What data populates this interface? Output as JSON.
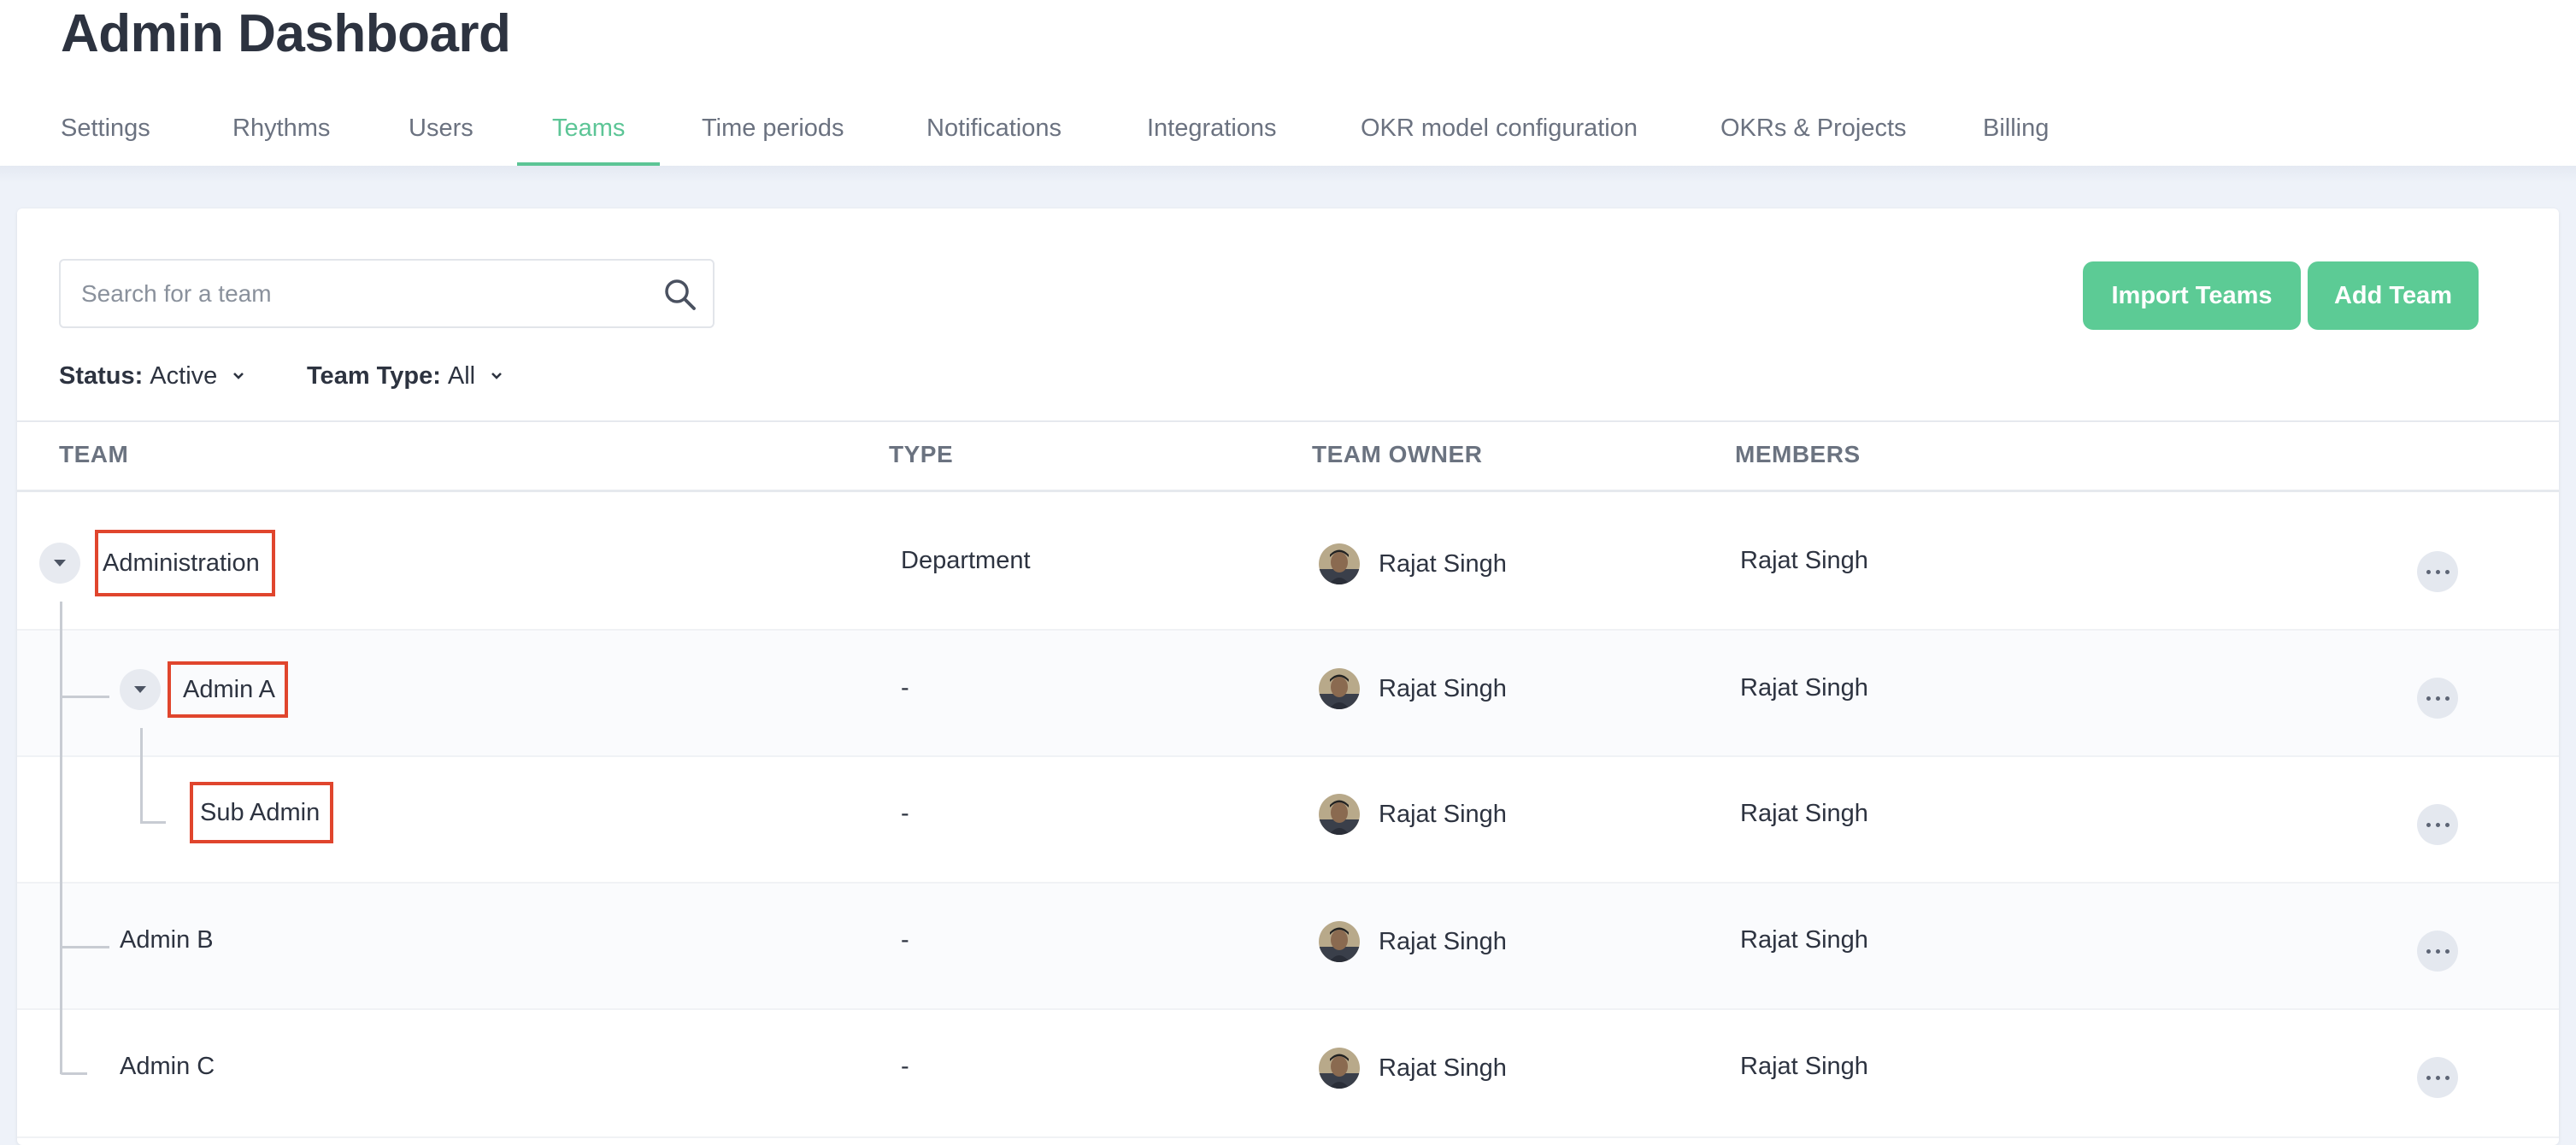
{
  "header": {
    "title": "Admin Dashboard",
    "tabs": [
      {
        "label": "Settings",
        "active": false
      },
      {
        "label": "Rhythms",
        "active": false
      },
      {
        "label": "Users",
        "active": false
      },
      {
        "label": "Teams",
        "active": true
      },
      {
        "label": "Time periods",
        "active": false
      },
      {
        "label": "Notifications",
        "active": false
      },
      {
        "label": "Integrations",
        "active": false
      },
      {
        "label": "OKR model configuration",
        "active": false
      },
      {
        "label": "OKRs & Projects",
        "active": false
      },
      {
        "label": "Billing",
        "active": false
      }
    ]
  },
  "toolbar": {
    "search_placeholder": "Search for a team",
    "search_value": "",
    "import_label": "Import Teams",
    "add_label": "Add Team"
  },
  "filters": {
    "status_label": "Status:",
    "status_value": "Active",
    "type_label": "Team Type:",
    "type_value": "All"
  },
  "table": {
    "columns": [
      "TEAM",
      "TYPE",
      "TEAM OWNER",
      "MEMBERS"
    ],
    "rows": [
      {
        "team": "Administration",
        "type": "Department",
        "owner": "Rajat Singh",
        "members": "Rajat Singh",
        "expanded": true,
        "highlighted": true
      },
      {
        "team": "Admin A",
        "type": "-",
        "owner": "Rajat Singh",
        "members": "Rajat Singh",
        "expanded": true,
        "highlighted": true
      },
      {
        "team": "Sub Admin",
        "type": "-",
        "owner": "Rajat Singh",
        "members": "Rajat Singh",
        "highlighted": true
      },
      {
        "team": "Admin B",
        "type": "-",
        "owner": "Rajat Singh",
        "members": "Rajat Singh",
        "highlighted": false
      },
      {
        "team": "Admin C",
        "type": "-",
        "owner": "Rajat Singh",
        "members": "Rajat Singh",
        "highlighted": false
      }
    ]
  },
  "colors": {
    "accent": "#5ccb95",
    "highlight": "#e0452d"
  },
  "icons": {
    "search": "search-icon",
    "chevron": "chevron-down-icon",
    "more": "more-icon",
    "toggle": "caret-down-icon"
  }
}
